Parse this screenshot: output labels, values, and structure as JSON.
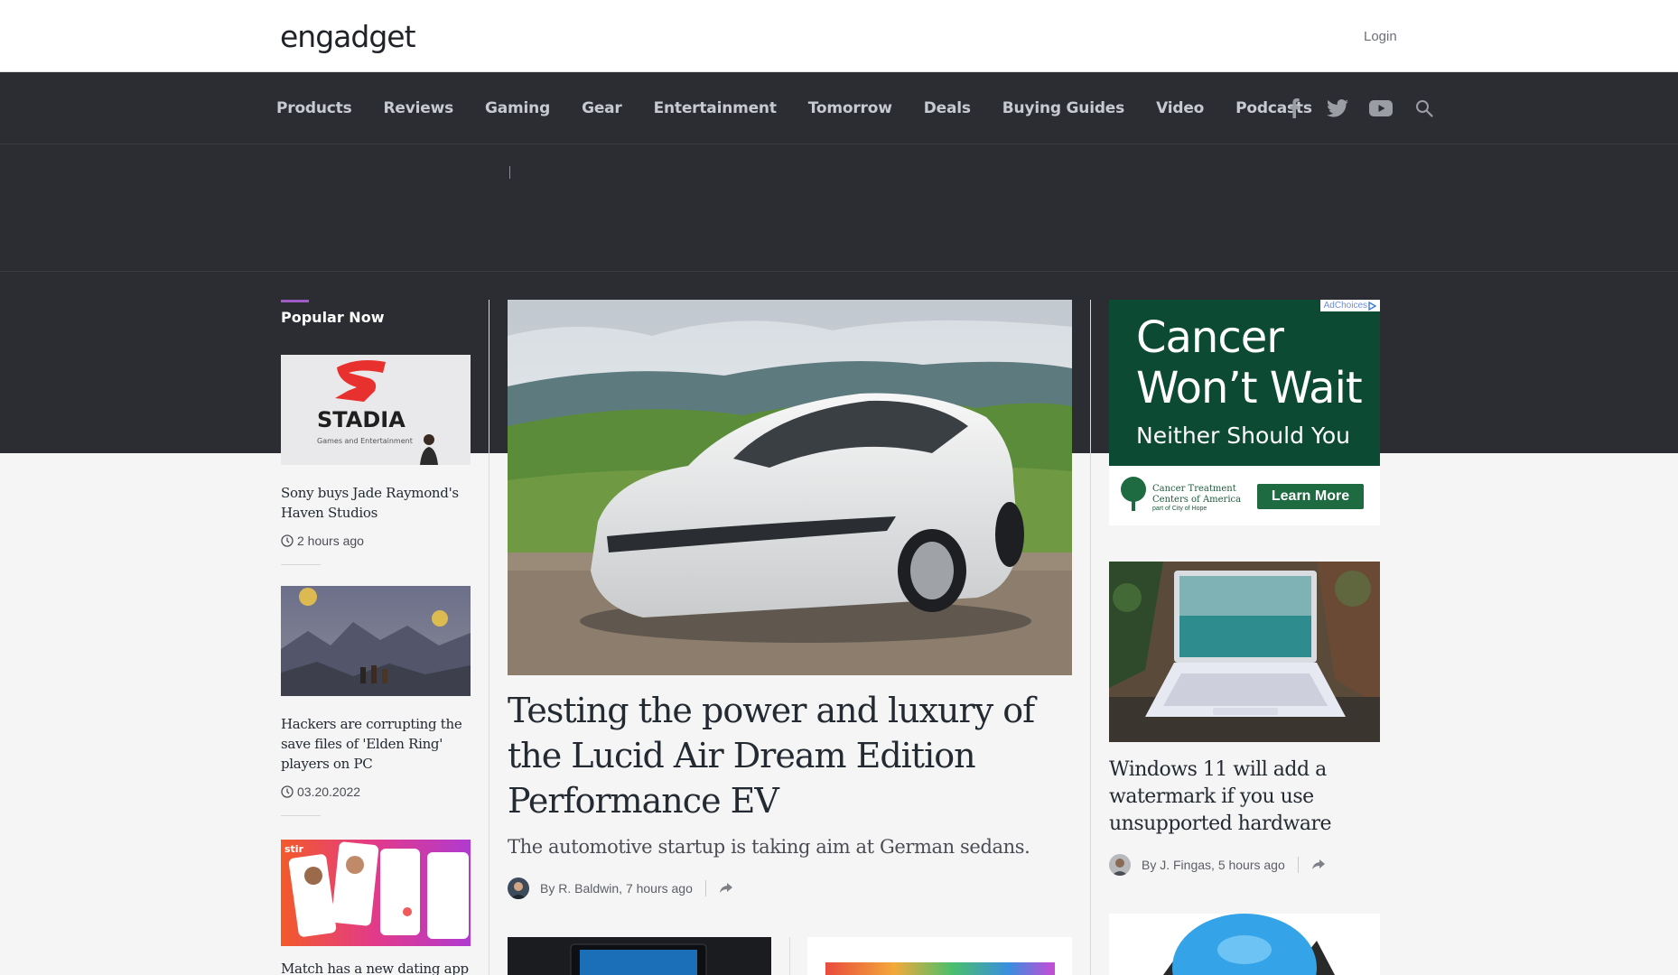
{
  "header": {
    "logo": "engadget",
    "login_label": "Login"
  },
  "nav": {
    "items": [
      "Products",
      "Reviews",
      "Gaming",
      "Gear",
      "Entertainment",
      "Tomorrow",
      "Deals",
      "Buying Guides",
      "Video",
      "Podcasts"
    ],
    "icons": [
      "facebook-icon",
      "twitter-icon",
      "youtube-icon",
      "search-icon"
    ]
  },
  "popular": {
    "title": "Popular Now",
    "items": [
      {
        "headline": "Sony buys Jade Raymond's Haven Studios",
        "time": "2 hours ago",
        "image_text": "STADIA",
        "image_subtext": "Games and Entertainment"
      },
      {
        "headline": "Hackers are corrupting the save files of 'Elden Ring' players on PC",
        "time": "03.20.2022"
      },
      {
        "headline": "Match has a new dating app",
        "image_tag": "stir"
      }
    ]
  },
  "hero": {
    "title": "Testing the power and luxury of the Lucid Air Dream Edition Performance EV",
    "subtitle": "The automotive startup is taking aim at German sedans.",
    "author": "By R. Baldwin",
    "time": "7 hours ago"
  },
  "ad": {
    "choices": "AdChoices",
    "headline_line1": "Cancer",
    "headline_line2": "Won’t Wait",
    "subline": "Neither  Should You",
    "org_line1": "Cancer Treatment",
    "org_line2": "Centers of America",
    "org_sub": "part of City of Hope",
    "cta": "Learn More"
  },
  "side_story": {
    "title": "Windows 11 will add a watermark if you use unsupported hardware",
    "author": "By J. Fingas",
    "time": "5 hours ago"
  },
  "colors": {
    "nav_bg": "#2b2d32",
    "accent": "#a05cc6",
    "page_bg": "#f5f5f6"
  }
}
